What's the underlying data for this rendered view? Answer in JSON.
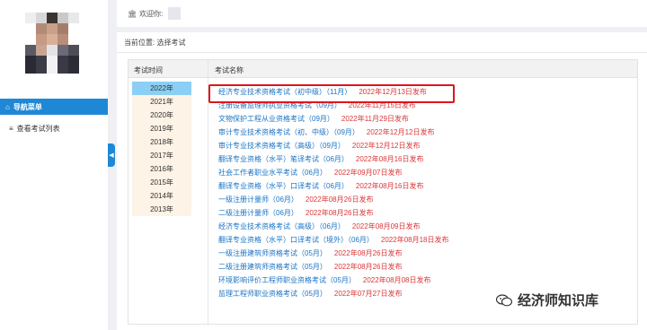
{
  "header": {
    "welcome": "欢迎你:"
  },
  "sidebar": {
    "nav_title": "导航菜单",
    "items": [
      {
        "label": "查看考试列表"
      }
    ]
  },
  "breadcrumb": "当前位置: 选择考试",
  "table": {
    "col_time": "考试时间",
    "col_name": "考试名称"
  },
  "years": [
    "2022年",
    "2021年",
    "2020年",
    "2019年",
    "2018年",
    "2017年",
    "2016年",
    "2015年",
    "2014年",
    "2013年"
  ],
  "exams": [
    {
      "name": "经济专业技术资格考试（初中级）（11月）",
      "date": "2022年12月13日发布"
    },
    {
      "name": "注册设备监理师执业资格考试（09月）",
      "date": "2022年11月15日发布"
    },
    {
      "name": "文物保护工程从业资格考试（09月）",
      "date": "2022年11月29日发布"
    },
    {
      "name": "审计专业技术资格考试（初、中级）（09月）",
      "date": "2022年12月12日发布"
    },
    {
      "name": "审计专业技术资格考试（高级）（09月）",
      "date": "2022年12月12日发布"
    },
    {
      "name": "翻译专业资格（水平）笔译考试（06月）",
      "date": "2022年08月16日发布"
    },
    {
      "name": "社会工作者职业水平考试（06月）",
      "date": "2022年09月07日发布"
    },
    {
      "name": "翻译专业资格（水平）口译考试（06月）",
      "date": "2022年08月16日发布"
    },
    {
      "name": "一级注册计量师（06月）",
      "date": "2022年08月26日发布"
    },
    {
      "name": "二级注册计量师（06月）",
      "date": "2022年08月26日发布"
    },
    {
      "name": "经济专业技术资格考试（高级）（06月）",
      "date": "2022年08月09日发布"
    },
    {
      "name": "翻译专业资格（水平）口译考试（境外）（06月）",
      "date": "2022年08月18日发布"
    },
    {
      "name": "一级注册建筑师资格考试（05月）",
      "date": "2022年08月26日发布"
    },
    {
      "name": "二级注册建筑师资格考试（05月）",
      "date": "2022年08月26日发布"
    },
    {
      "name": "环境影响评价工程师职业资格考试（05月）",
      "date": "2022年08月08日发布"
    },
    {
      "name": "监理工程师职业资格考试（05月）",
      "date": "2022年07月27日发布"
    }
  ],
  "watermark": "经济师知识库",
  "colors": {
    "accent": "#1e88d6",
    "link": "#1a73c4",
    "date": "#d9383a",
    "highlight": "#e0141e",
    "active_year": "#8ccff5",
    "year_bg": "#fdf3e6"
  },
  "icons": {
    "home": "home-icon",
    "nav": "home-icon",
    "list": "list-icon",
    "collapse": "chevron-left-icon",
    "avatar": "avatar"
  }
}
